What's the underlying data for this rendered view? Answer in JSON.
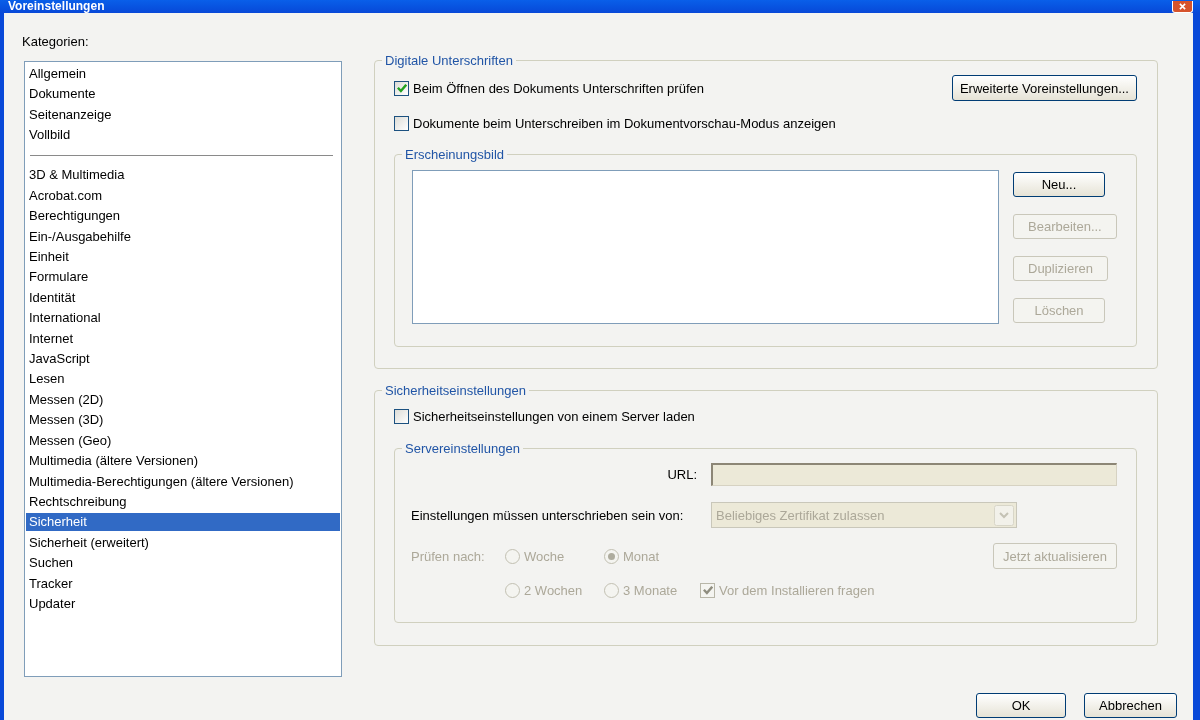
{
  "window": {
    "title": "Voreinstellungen"
  },
  "categories": {
    "label": "Kategorien:",
    "groups": [
      {
        "items": [
          {
            "label": "Allgemein",
            "selected": false
          },
          {
            "label": "Dokumente",
            "selected": false
          },
          {
            "label": "Seitenanzeige",
            "selected": false
          },
          {
            "label": "Vollbild",
            "selected": false
          }
        ]
      },
      {
        "items": [
          {
            "label": "3D & Multimedia",
            "selected": false
          },
          {
            "label": "Acrobat.com",
            "selected": false
          },
          {
            "label": "Berechtigungen",
            "selected": false
          },
          {
            "label": "Ein-/Ausgabehilfe",
            "selected": false
          },
          {
            "label": "Einheit",
            "selected": false
          },
          {
            "label": "Formulare",
            "selected": false
          },
          {
            "label": "Identität",
            "selected": false
          },
          {
            "label": "International",
            "selected": false
          },
          {
            "label": "Internet",
            "selected": false
          },
          {
            "label": "JavaScript",
            "selected": false
          },
          {
            "label": "Lesen",
            "selected": false
          },
          {
            "label": "Messen (2D)",
            "selected": false
          },
          {
            "label": "Messen (3D)",
            "selected": false
          },
          {
            "label": "Messen (Geo)",
            "selected": false
          },
          {
            "label": "Multimedia (ältere Versionen)",
            "selected": false
          },
          {
            "label": "Multimedia-Berechtigungen (ältere Versionen)",
            "selected": false
          },
          {
            "label": "Rechtschreibung",
            "selected": false
          },
          {
            "label": "Sicherheit",
            "selected": true
          },
          {
            "label": "Sicherheit (erweitert)",
            "selected": false
          },
          {
            "label": "Suchen",
            "selected": false
          },
          {
            "label": "Tracker",
            "selected": false
          },
          {
            "label": "Updater",
            "selected": false
          }
        ]
      }
    ]
  },
  "digital_signatures": {
    "title": "Digitale Unterschriften",
    "options": [
      {
        "label": "Beim Öffnen des Dokuments Unterschriften prüfen",
        "checked": true
      },
      {
        "label": "Dokumente beim Unterschreiben im Dokumentvorschau-Modus anzeigen",
        "checked": false
      }
    ],
    "advanced_button": {
      "label": "Erweiterte Voreinstellungen..."
    },
    "appearance": {
      "title": "Erscheinungsbild",
      "buttons": [
        {
          "label": "Neu...",
          "disabled": false
        },
        {
          "label": "Bearbeiten...",
          "disabled": true
        },
        {
          "label": "Duplizieren",
          "disabled": true
        },
        {
          "label": "Löschen",
          "disabled": true
        }
      ]
    }
  },
  "security": {
    "title": "Sicherheitseinstellungen",
    "load_from_server": {
      "label": "Sicherheitseinstellungen von einem Server laden",
      "checked": false
    },
    "server_settings": {
      "title": "Servereinstellungen",
      "url": {
        "label": "URL:",
        "disabled": true
      },
      "signed_by": {
        "label": "Einstellungen müssen unterschrieben sein von:",
        "value": "Beliebiges Zertifikat zulassen",
        "disabled": true
      },
      "check_interval": {
        "label": "Prüfen nach:",
        "disabled": true,
        "options": [
          {
            "label": "Woche",
            "selected": false
          },
          {
            "label": "Monat",
            "selected": true
          },
          {
            "label": "2 Wochen",
            "selected": false
          },
          {
            "label": "3 Monate",
            "selected": false
          }
        ]
      },
      "update_button": {
        "label": "Jetzt aktualisieren",
        "disabled": true
      },
      "ask_before_install": {
        "label": "Vor dem Installieren fragen",
        "checked": true,
        "disabled": true
      }
    }
  },
  "buttons": [
    {
      "label": "OK"
    },
    {
      "label": "Abbrechen"
    }
  ]
}
